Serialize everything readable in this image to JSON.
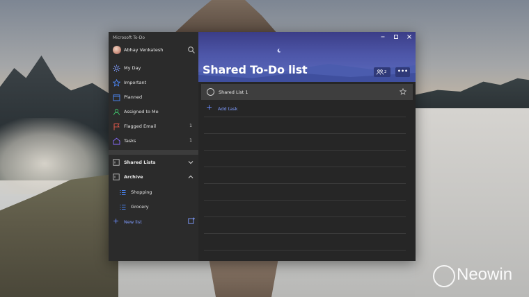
{
  "window": {
    "app_title": "Microsoft To-Do",
    "user_name": "Abhay Venkatesh"
  },
  "sidebar": {
    "nav": [
      {
        "label": "My Day",
        "count": "",
        "icon": "sun-icon"
      },
      {
        "label": "Important",
        "count": "",
        "icon": "star-icon"
      },
      {
        "label": "Planned",
        "count": "",
        "icon": "calendar-icon"
      },
      {
        "label": "Assigned to Me",
        "count": "",
        "icon": "person-icon"
      },
      {
        "label": "Flagged Email",
        "count": "1",
        "icon": "flag-icon"
      },
      {
        "label": "Tasks",
        "count": "1",
        "icon": "home-icon"
      }
    ],
    "groups": [
      {
        "label": "Shared Lists",
        "expanded": false
      },
      {
        "label": "Archive",
        "expanded": true
      }
    ],
    "archive_items": [
      {
        "label": "Shopping"
      },
      {
        "label": "Grocery"
      }
    ],
    "new_list_label": "New list"
  },
  "main": {
    "list_title": "Shared To-Do list",
    "share_count": "2",
    "more_label": "•••",
    "tasks": [
      {
        "title": "Shared List 1",
        "completed": false,
        "important": false
      }
    ],
    "add_task_label": "Add task"
  },
  "watermark": {
    "text": "Neowin"
  },
  "colors": {
    "accent": "#7f9cff",
    "banner": "#4d56a8",
    "sidebar_bg": "#2b2b2b",
    "main_bg": "#262626"
  }
}
